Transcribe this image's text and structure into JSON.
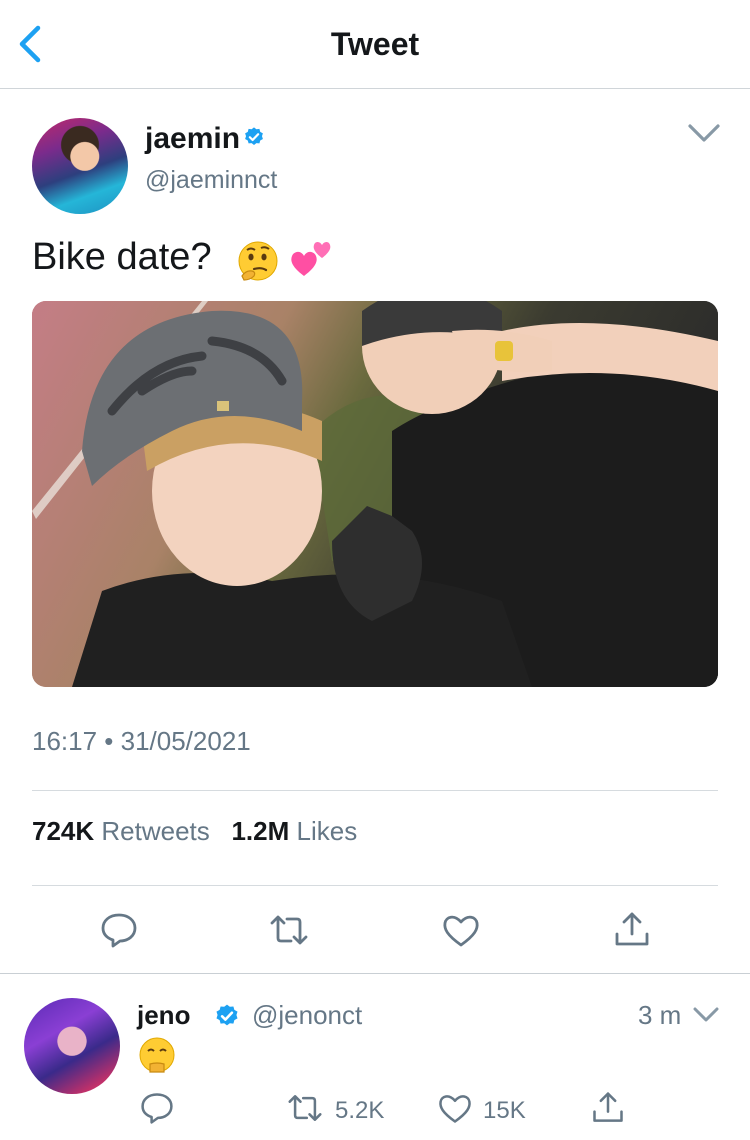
{
  "header": {
    "title": "Tweet",
    "back_icon": "chevron-left-icon"
  },
  "tweet": {
    "author_name": "jaemin",
    "author_handle": "@jaeminnct",
    "verified": true,
    "text": "Bike date?",
    "emojis": [
      "thinking-face-icon",
      "two-hearts-icon"
    ],
    "timestamp": "16:17 • 31/05/2021",
    "retweets_count": "724K",
    "retweets_label": "Retweets",
    "likes_count": "1.2M",
    "likes_label": "Likes",
    "actions": [
      "reply-icon",
      "retweet-icon",
      "like-icon",
      "share-icon"
    ]
  },
  "reply": {
    "author_name": "jeno",
    "author_handle": "@jenonct",
    "verified": true,
    "age": "3 m",
    "emoji": "shushing-face-icon",
    "retweets": "5.2K",
    "likes": "15K"
  },
  "colors": {
    "accent": "#1da1f2",
    "secondary_text": "#657786",
    "divider": "#d6dbdf"
  }
}
